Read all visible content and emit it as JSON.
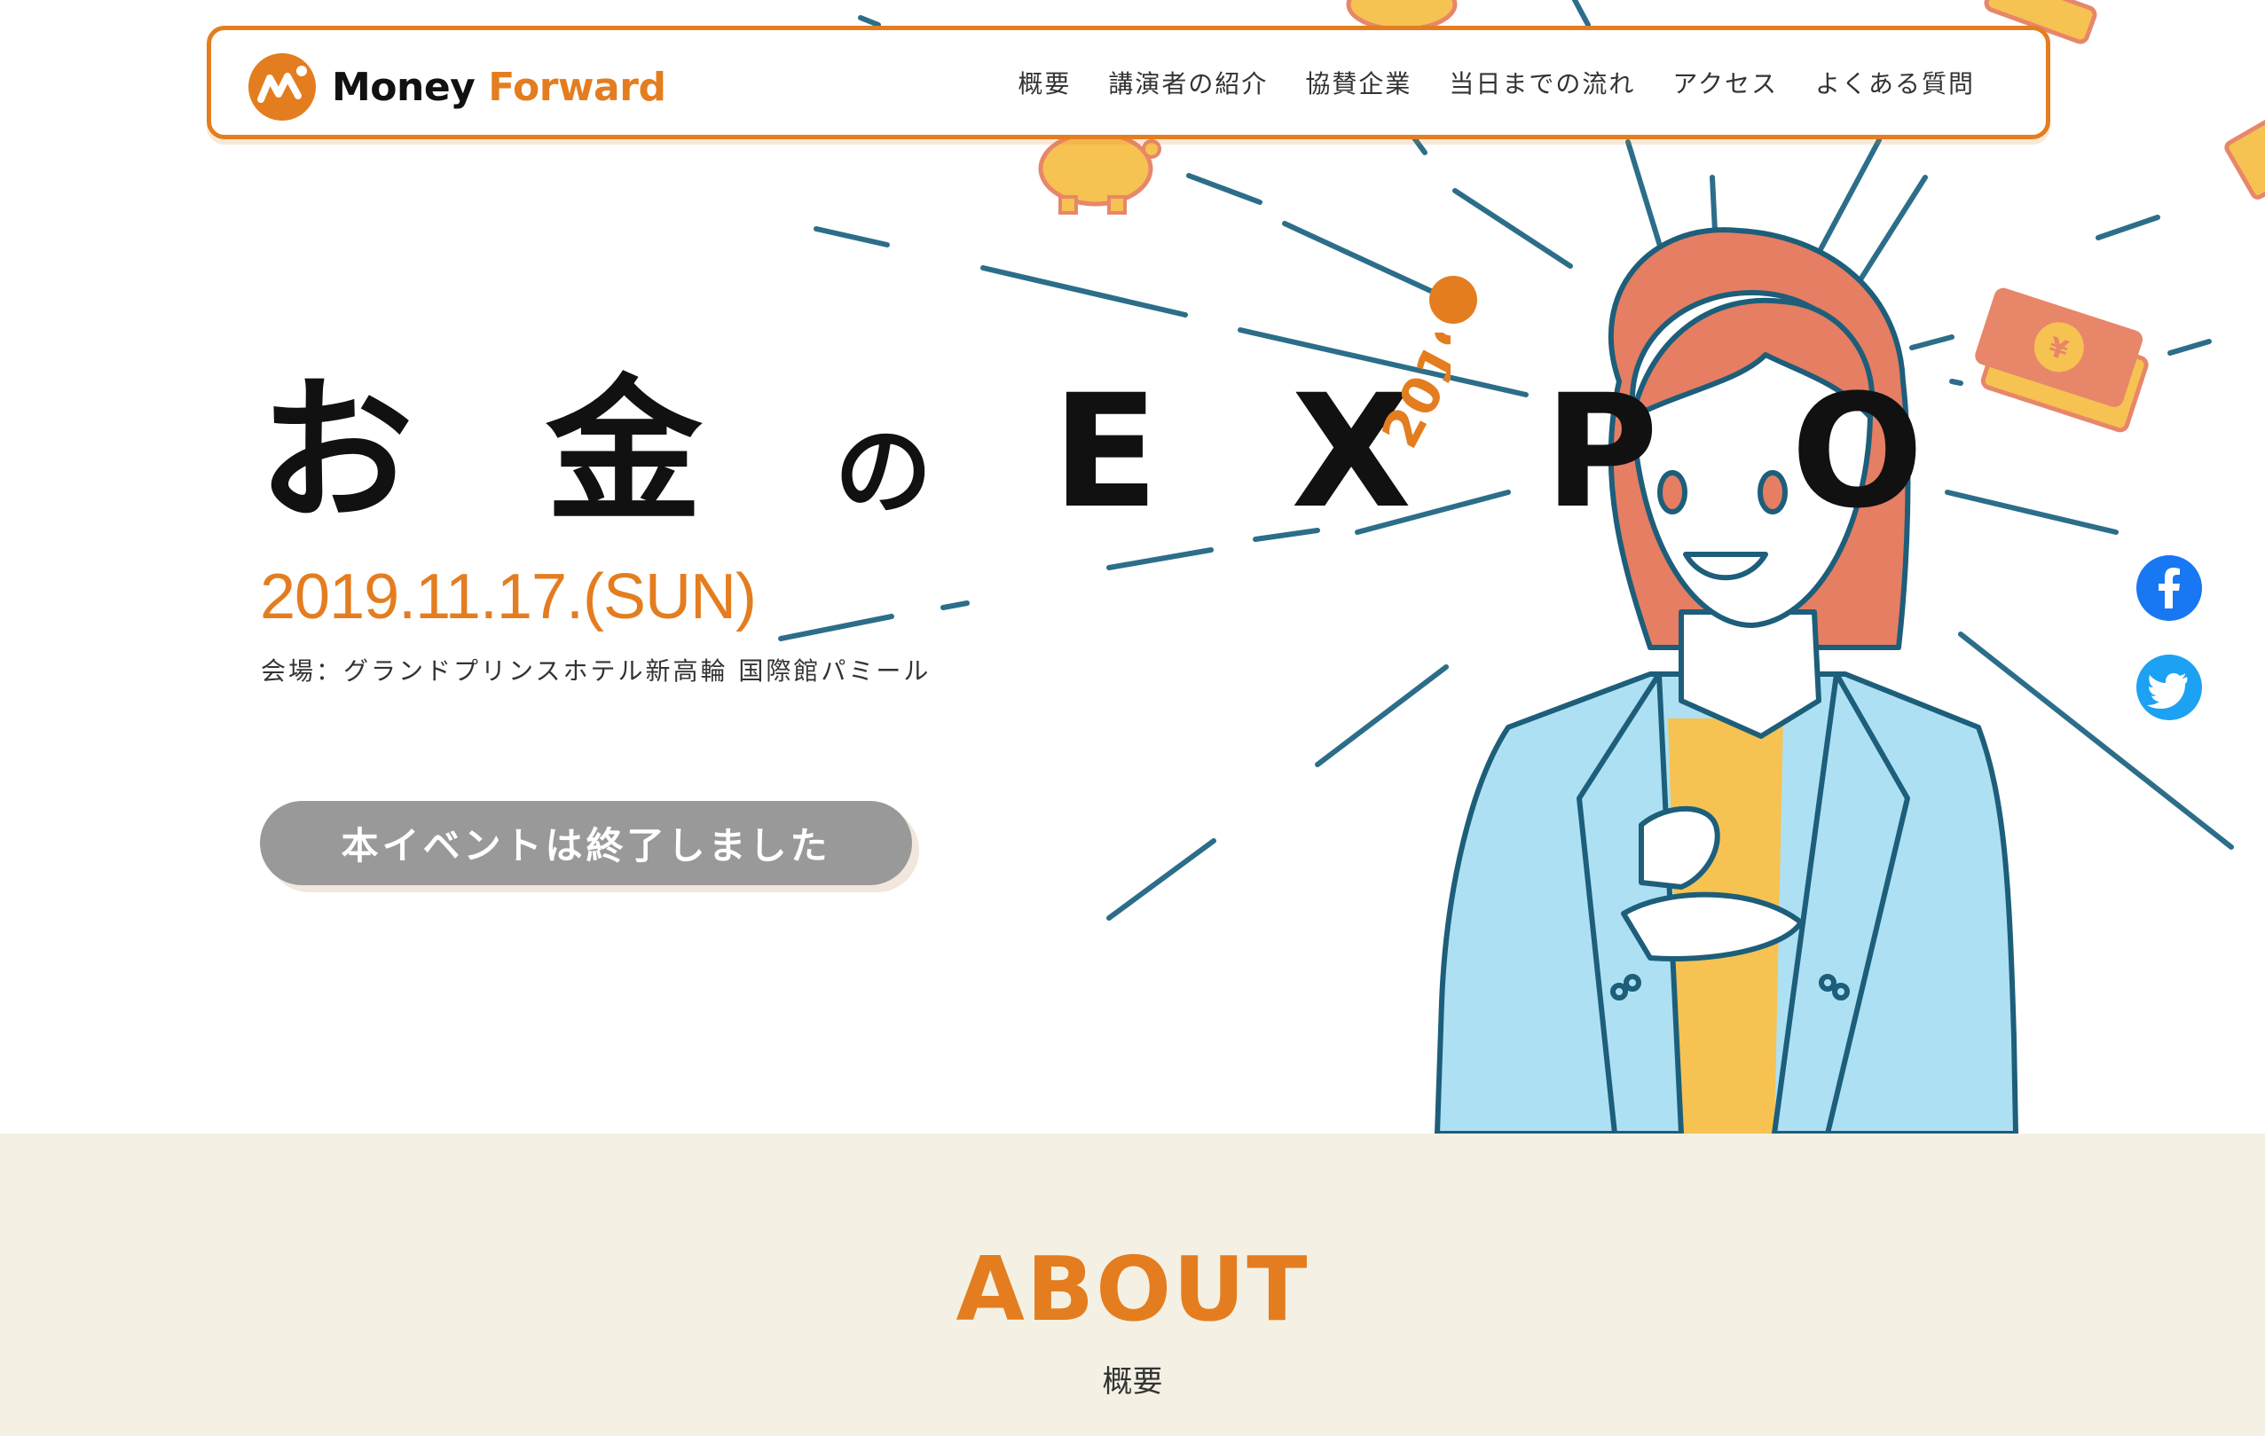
{
  "header": {
    "logo_main": "Money",
    "logo_accent": "Forward",
    "nav": [
      "概要",
      "講演者の紹介",
      "協賛企業",
      "当日までの流れ",
      "アクセス",
      "よくある質問"
    ]
  },
  "hero": {
    "title_a": "お 金",
    "title_b": "の",
    "title_c": "E X P O",
    "year_badge": "2019",
    "date": "2019.11.17.(SUN)",
    "venue": "会場：グランドプリンスホテル新高輪 国際館パミール",
    "status_button": "本イベントは終了しました"
  },
  "social": {
    "facebook": "facebook-icon",
    "twitter": "twitter-icon"
  },
  "about": {
    "title": "ABOUT",
    "subtitle": "概要"
  },
  "colors": {
    "accent": "#e47d1f",
    "about_bg": "#f4f1e4",
    "button": "#999999"
  }
}
